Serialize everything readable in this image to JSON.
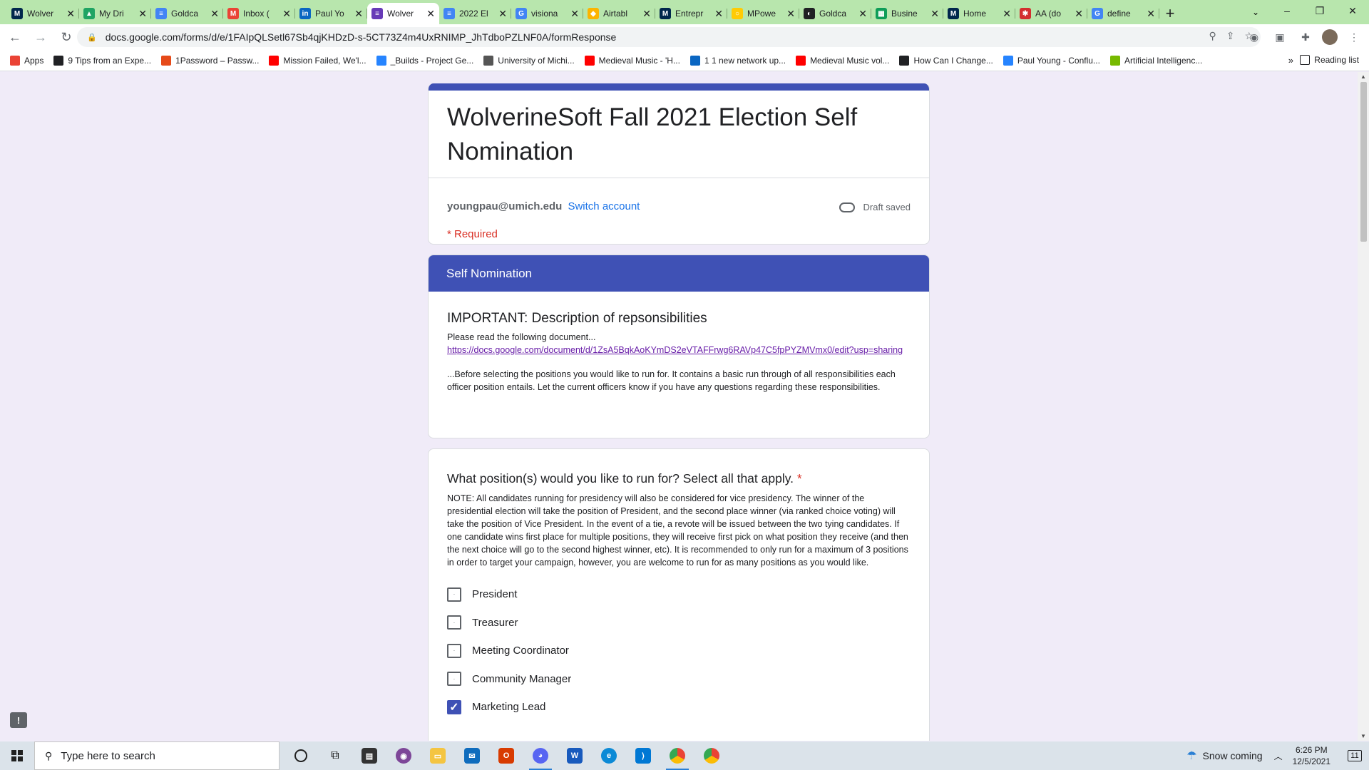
{
  "browser": {
    "tabs": [
      {
        "label": "Wolver",
        "color": "#00274c",
        "glyph": "M",
        "active": false
      },
      {
        "label": "My Dri",
        "color": "#1fa463",
        "glyph": "▲",
        "active": false
      },
      {
        "label": "Goldca",
        "color": "#4285f4",
        "glyph": "≡",
        "active": false
      },
      {
        "label": "Inbox (",
        "color": "#ea4335",
        "glyph": "M",
        "active": false
      },
      {
        "label": "Paul Yo",
        "color": "#0a66c2",
        "glyph": "in",
        "active": false
      },
      {
        "label": "Wolver",
        "color": "#673ab7",
        "glyph": "≡",
        "active": true
      },
      {
        "label": "2022 El",
        "color": "#4285f4",
        "glyph": "≡",
        "active": false
      },
      {
        "label": "visiona",
        "color": "#4285f4",
        "glyph": "G",
        "active": false
      },
      {
        "label": "Airtabl",
        "color": "#fcb400",
        "glyph": "◆",
        "active": false
      },
      {
        "label": "Entrepr",
        "color": "#00274c",
        "glyph": "M",
        "active": false
      },
      {
        "label": "MPowe",
        "color": "#ffcb05",
        "glyph": "○",
        "active": false
      },
      {
        "label": "Goldca",
        "color": "#202124",
        "glyph": "◐",
        "active": false
      },
      {
        "label": "Busine",
        "color": "#0f9d58",
        "glyph": "▦",
        "active": false
      },
      {
        "label": "Home",
        "color": "#00274c",
        "glyph": "M",
        "active": false
      },
      {
        "label": "AA (do",
        "color": "#d32f2f",
        "glyph": "✱",
        "active": false
      },
      {
        "label": "define",
        "color": "#4285f4",
        "glyph": "G",
        "active": false
      }
    ],
    "url": "docs.google.com/forms/d/e/1FAIpQLSetl67Sb4qjKHDzD-s-5CT73Z4m4UxRNIMP_JhTdboPZLNF0A/formResponse",
    "bookmarks": [
      {
        "label": "Apps",
        "color": "#ea4335"
      },
      {
        "label": "9 Tips from an Expe...",
        "color": "#202124"
      },
      {
        "label": "1Password – Passw...",
        "color": "#e64a19"
      },
      {
        "label": "Mission Failed, We'l...",
        "color": "#ff0000"
      },
      {
        "label": "_Builds - Project Ge...",
        "color": "#2684ff"
      },
      {
        "label": "University of Michi...",
        "color": "#555555"
      },
      {
        "label": "Medieval Music - 'H...",
        "color": "#ff0000"
      },
      {
        "label": "1 1 new network up...",
        "color": "#0a66c2"
      },
      {
        "label": "Medieval Music vol...",
        "color": "#ff0000"
      },
      {
        "label": "How Can I Change...",
        "color": "#202124"
      },
      {
        "label": "Paul Young - Conflu...",
        "color": "#2684ff"
      },
      {
        "label": "Artificial Intelligenc...",
        "color": "#76b900"
      }
    ],
    "more_bookmarks": "»",
    "reading_list": "Reading list"
  },
  "form": {
    "title": "WolverineSoft Fall 2021 Election Self Nomination",
    "account_email": "youngpau@umich.edu",
    "switch_account": "Switch account",
    "draft_status": "Draft saved",
    "required_note": "* Required",
    "section_title": "Self Nomination",
    "description_heading": "IMPORTANT: Description of repsonsibilities",
    "description_intro": "Please read the following document...",
    "description_link": "https://docs.google.com/document/d/1ZsA5BqkAoKYmDS2eVTAFFrwg6RAVp47C5fpPYZMVmx0/edit?usp=sharing",
    "description_outro": "...Before selecting the positions you would like to run for. It contains a basic run through of all responsibilities each officer position entails. Let the current officers know if you have any questions regarding these responsibilities.",
    "question_title": "What position(s) would you like to run for? Select all that apply.",
    "question_required_mark": "*",
    "question_note": "NOTE: All candidates running for presidency will also be considered for vice presidency. The winner of the presidential election will take the position of President, and the second place winner (via ranked choice voting) will take the position of Vice President. In the event of a tie, a revote will be issued between the two tying candidates. If one candidate wins first place for multiple positions, they will receive first pick on what position they receive (and then the next choice will go to the second highest winner, etc). It is recommended to only run for a maximum of 3 positions in order to target your campaign, however, you are welcome to run for as many positions as you would like.",
    "options": [
      {
        "label": "President",
        "checked": false
      },
      {
        "label": "Treasurer",
        "checked": false
      },
      {
        "label": "Meeting Coordinator",
        "checked": false
      },
      {
        "label": "Community Manager",
        "checked": false
      },
      {
        "label": "Marketing Lead",
        "checked": true
      }
    ]
  },
  "taskbar": {
    "search_placeholder": "Type here to search",
    "weather": "Snow coming",
    "time": "6:26 PM",
    "date": "12/5/2021",
    "notification_count": "11"
  },
  "colors": {
    "form_accent": "#3f51b5",
    "page_bg": "#f0ebf8",
    "tab_strip": "#b8e6ad",
    "required": "#d93025",
    "link": "#1a73e8"
  }
}
